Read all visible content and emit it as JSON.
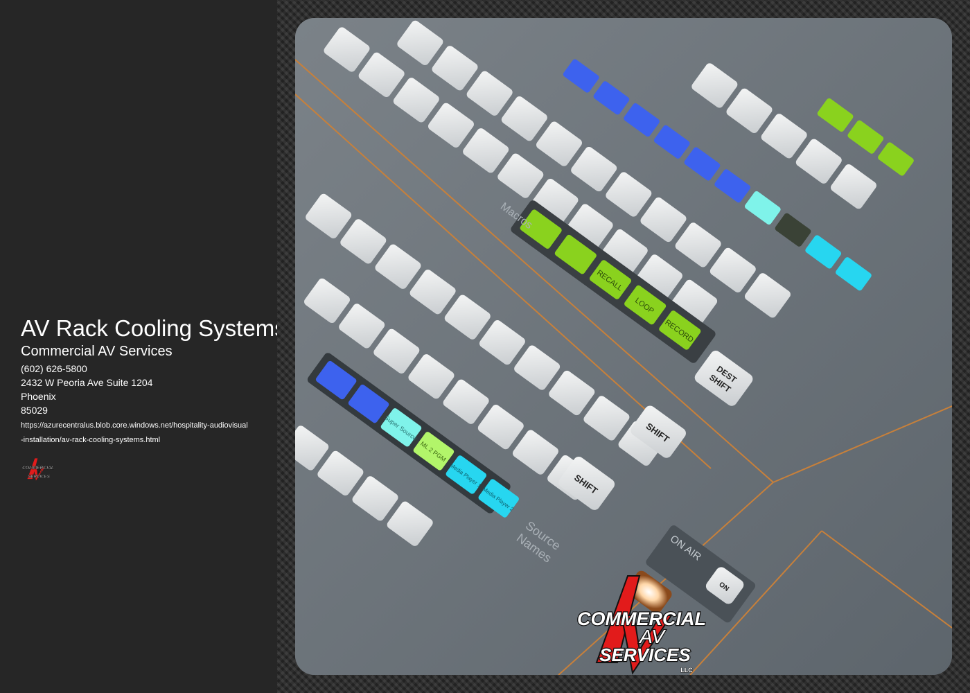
{
  "business": {
    "page_title": "AV Rack Cooling Systems",
    "company_name": "Commercial AV Services",
    "phone": "(602) 626-5800",
    "address": "2432 W Peoria Ave Suite 1204",
    "city": "Phoenix",
    "zip": "85029",
    "url": "https://azurecentralus.blob.core.windows.net/hospitality-audiovisual-installation/av-rack-cooling-systems.html"
  },
  "logo": {
    "line1": "COMMERCIAL",
    "line2": "AV",
    "line3": "SERVICES",
    "suffix": "LLC",
    "colors": {
      "red": "#e21b1b",
      "black": "#111111",
      "white": "#ffffff"
    }
  },
  "photo": {
    "labels": {
      "macros": "Macros",
      "source_names_1": "Source",
      "source_names_2": "Names",
      "shift_1": "SHIFT",
      "shift_2": "SHIFT",
      "dest_shift_1": "DEST",
      "dest_shift_2": "SHIFT",
      "on_air": "ON AIR",
      "on": "ON",
      "recall": "RECALL",
      "loop": "LOOP",
      "record": "RECORD",
      "super_source": "Super Source",
      "ml_pgm": "ML 2 PGM",
      "media_player_1": "Media Player 1",
      "media_player_2": "Media Player 2"
    },
    "colors": {
      "panel": "#6c737a",
      "key_white": "#e4e6e6",
      "accent_orange": "#c8803a",
      "green": "#8ad21e",
      "blue": "#3d62ee",
      "cyan": "#27d6f0"
    }
  }
}
